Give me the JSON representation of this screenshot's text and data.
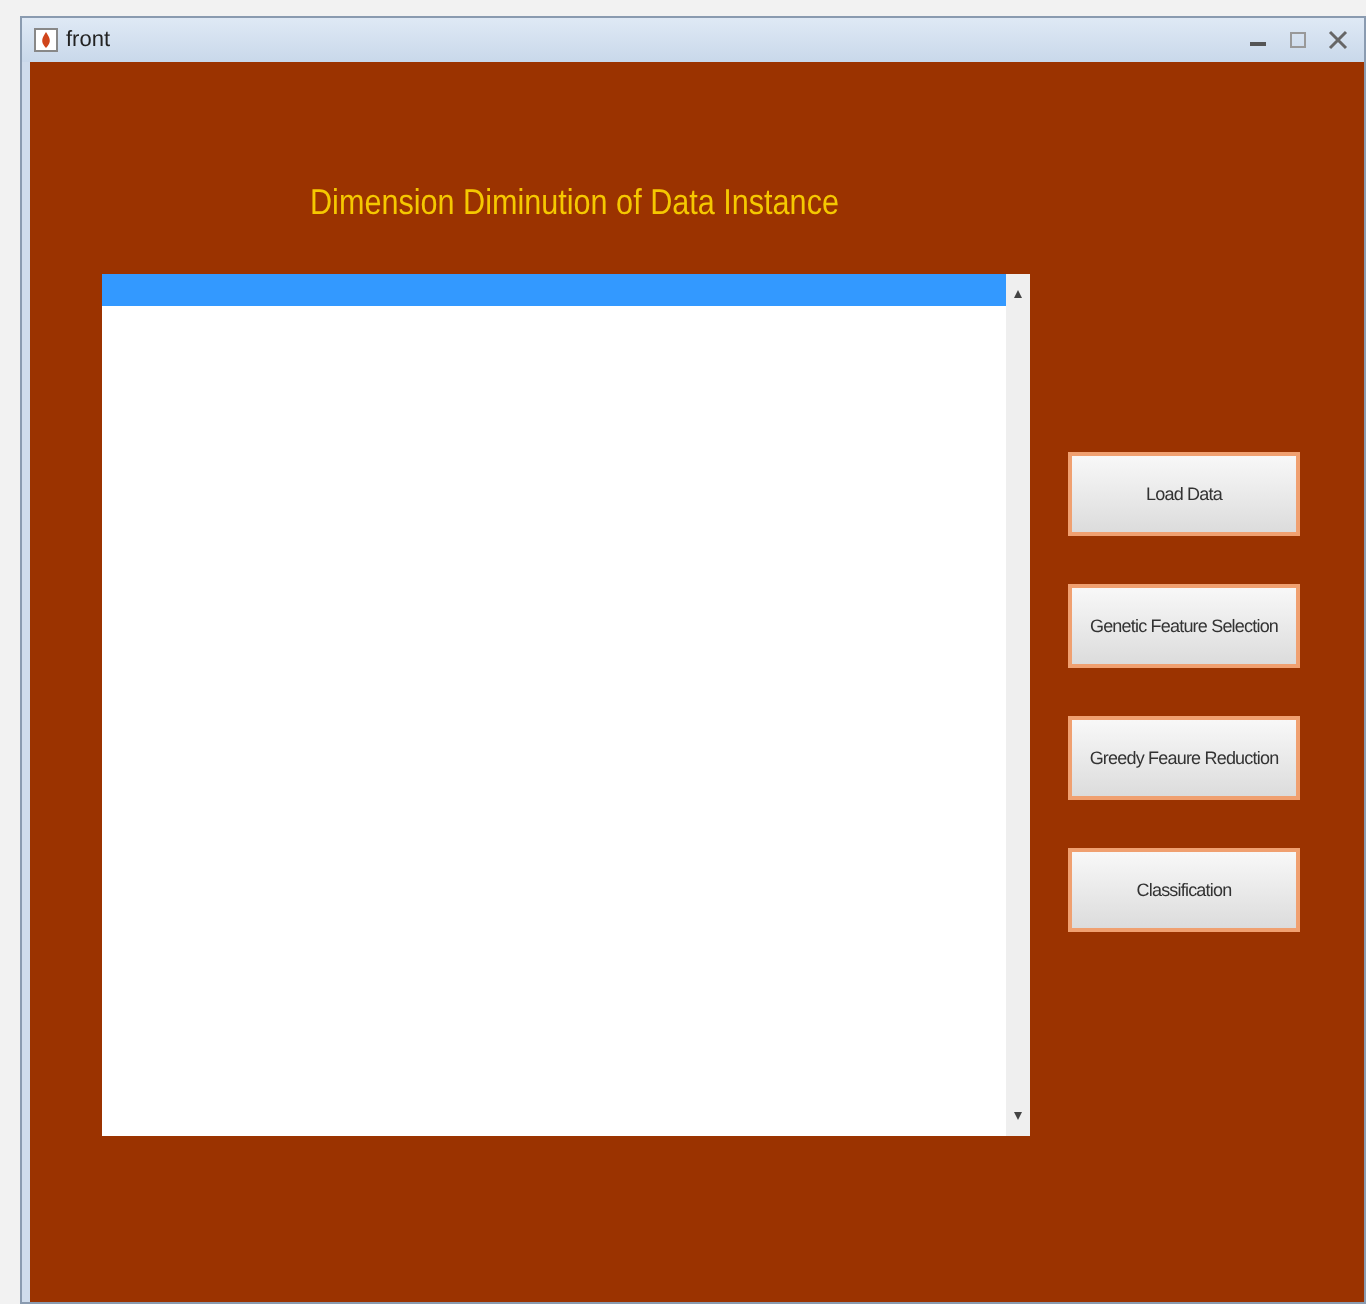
{
  "window": {
    "title": "front"
  },
  "heading": "Dimension Diminution of Data Instance",
  "list": {
    "rows": [
      {
        "selected": true
      }
    ]
  },
  "buttons": [
    {
      "label": "Load Data"
    },
    {
      "label": "Genetic Feature Selection"
    },
    {
      "label": "Greedy Feaure Reduction"
    },
    {
      "label": "Classification"
    }
  ]
}
